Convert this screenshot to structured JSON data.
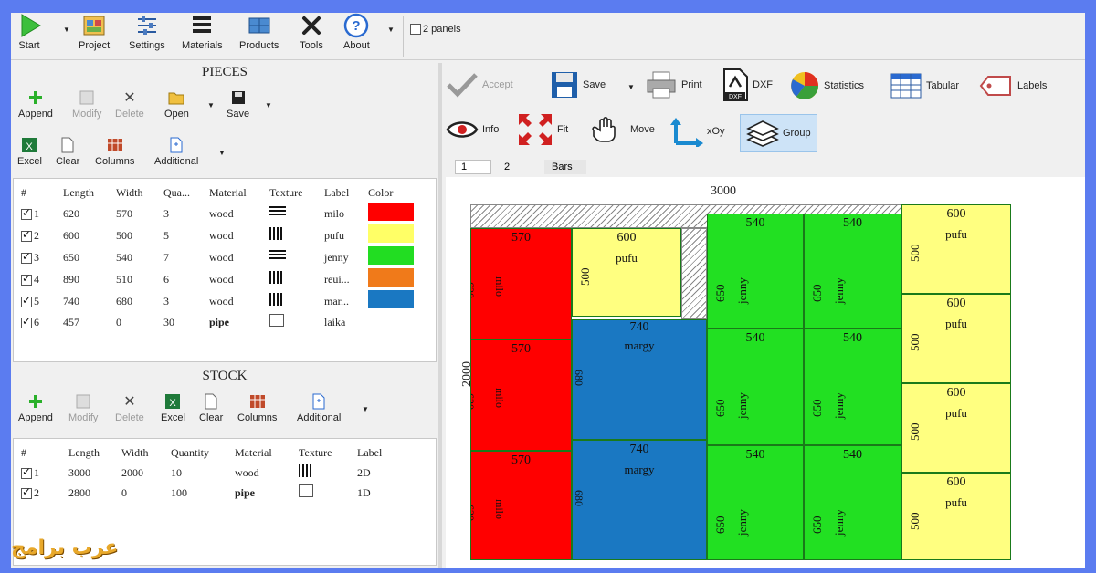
{
  "toolbar": {
    "start": "Start",
    "project": "Project",
    "settings": "Settings",
    "materials": "Materials",
    "products": "Products",
    "tools": "Tools",
    "about": "About",
    "two_panels": "2 panels"
  },
  "pieces": {
    "title": "PIECES",
    "buttons": {
      "append": "Append",
      "modify": "Modify",
      "delete": "Delete",
      "open": "Open",
      "save": "Save",
      "excel": "Excel",
      "clear": "Clear",
      "columns": "Columns",
      "additional": "Additional"
    },
    "columns": [
      "#",
      "Length",
      "Width",
      "Qua...",
      "Material",
      "Texture",
      "Label",
      "Color"
    ],
    "rows": [
      {
        "n": "1",
        "length": "620",
        "width": "570",
        "qty": "3",
        "material": "wood",
        "texture": "horizontal",
        "label": "milo",
        "color": "#ff0000"
      },
      {
        "n": "2",
        "length": "600",
        "width": "500",
        "qty": "5",
        "material": "wood",
        "texture": "vertical",
        "label": "pufu",
        "color": "#ffff66"
      },
      {
        "n": "3",
        "length": "650",
        "width": "540",
        "qty": "7",
        "material": "wood",
        "texture": "horizontal",
        "label": "jenny",
        "color": "#22dd22"
      },
      {
        "n": "4",
        "length": "890",
        "width": "510",
        "qty": "6",
        "material": "wood",
        "texture": "vertical",
        "label": "reui...",
        "color": "#f07a1a"
      },
      {
        "n": "5",
        "length": "740",
        "width": "680",
        "qty": "3",
        "material": "wood",
        "texture": "vertical",
        "label": "mar...",
        "color": "#1a78c2"
      },
      {
        "n": "6",
        "length": "457",
        "width": "0",
        "qty": "30",
        "material": "pipe",
        "texture": "none",
        "label": "laika",
        "color": ""
      }
    ]
  },
  "stock": {
    "title": "STOCK",
    "buttons": {
      "append": "Append",
      "modify": "Modify",
      "delete": "Delete",
      "excel": "Excel",
      "clear": "Clear",
      "columns": "Columns",
      "additional": "Additional"
    },
    "columns": [
      "#",
      "Length",
      "Width",
      "Quantity",
      "Material",
      "Texture",
      "Label"
    ],
    "rows": [
      {
        "n": "1",
        "length": "3000",
        "width": "2000",
        "qty": "10",
        "material": "wood",
        "texture": "vertical",
        "label": "2D"
      },
      {
        "n": "2",
        "length": "2800",
        "width": "0",
        "qty": "100",
        "material": "pipe",
        "texture": "none",
        "label": "1D"
      }
    ]
  },
  "right": {
    "accept": "Accept",
    "save": "Save",
    "print": "Print",
    "dxf": "DXF",
    "statistics": "Statistics",
    "tabular": "Tabular",
    "labels": "Labels",
    "info": "Info",
    "fit": "Fit",
    "move": "Move",
    "xoy": "xOy",
    "group": "Group",
    "tabs": [
      "1",
      "2",
      "Bars"
    ]
  },
  "sheet": {
    "width_label": "3000",
    "height_label": "2000",
    "blocks": [
      {
        "w": "570",
        "h": "620",
        "label": "milo",
        "color": "#ff0000"
      },
      {
        "w": "570",
        "h": "620",
        "label": "milo",
        "color": "#ff0000"
      },
      {
        "w": "570",
        "h": "620",
        "label": "milo",
        "color": "#ff0000"
      },
      {
        "w": "600",
        "h": "500",
        "label": "pufu",
        "color": "#ffff80"
      },
      {
        "w": "740",
        "h": "680",
        "label": "margy",
        "color": "#1a78c2"
      },
      {
        "w": "740",
        "h": "680",
        "label": "margy",
        "color": "#1a78c2"
      },
      {
        "w": "540",
        "h": "650",
        "label": "jenny",
        "color": "#22e022"
      },
      {
        "w": "540",
        "h": "650",
        "label": "jenny",
        "color": "#22e022"
      },
      {
        "w": "540",
        "h": "650",
        "label": "jenny",
        "color": "#22e022"
      },
      {
        "w": "540",
        "h": "650",
        "label": "jenny",
        "color": "#22e022"
      },
      {
        "w": "540",
        "h": "650",
        "label": "jenny",
        "color": "#22e022"
      },
      {
        "w": "540",
        "h": "650",
        "label": "jenny",
        "color": "#22e022"
      },
      {
        "w": "600",
        "h": "500",
        "label": "pufu",
        "color": "#ffff80"
      },
      {
        "w": "600",
        "h": "500",
        "label": "pufu",
        "color": "#ffff80"
      },
      {
        "w": "600",
        "h": "500",
        "label": "pufu",
        "color": "#ffff80"
      },
      {
        "w": "600",
        "h": "500",
        "label": "pufu",
        "color": "#ffff80"
      }
    ]
  },
  "watermark": "عرب برامج"
}
